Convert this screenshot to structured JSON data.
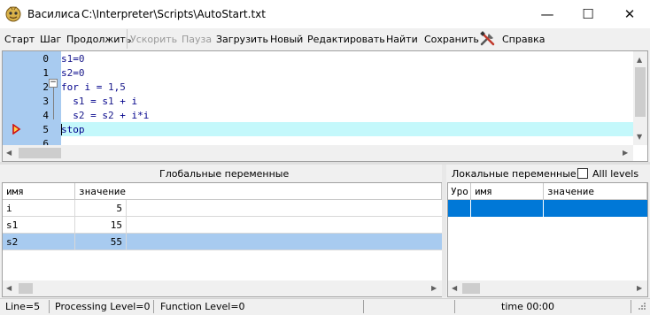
{
  "window": {
    "app_name": "Василиса",
    "file_path": "C:\\Interpreter\\Scripts\\AutoStart.txt",
    "minimize_glyph": "—",
    "maximize_glyph": "☐",
    "close_glyph": "✕"
  },
  "menu": {
    "start": "Старт",
    "step": "Шаг",
    "continue": "Продолжить",
    "speed_up": "Ускорить",
    "pause": "Пауза",
    "load": "Загрузить",
    "new": "Новый",
    "edit": "Редактировать",
    "find": "Найти",
    "save": "Сохранить",
    "help": "Справка"
  },
  "editor": {
    "line_numbers": [
      "0",
      "1",
      "2",
      "3",
      "4",
      "5",
      "6"
    ],
    "lines": [
      "s1=0",
      "s2=0",
      "for i = 1,5",
      "  s1 = s1 + i",
      "  s2 = s2 + i*i",
      "stop",
      ""
    ],
    "current_line": 5,
    "fold_glyph": "−"
  },
  "globals": {
    "title": "Глобальные переменные",
    "col_name": "имя",
    "col_value": "значение",
    "rows": [
      {
        "name": "i",
        "value": "5"
      },
      {
        "name": "s1",
        "value": "15"
      },
      {
        "name": "s2",
        "value": "55"
      }
    ],
    "selected_row": 2
  },
  "locals": {
    "title": "Локальные переменные",
    "all_levels_label": "Alll levels",
    "all_levels_checked": false,
    "col_level": "Уро",
    "col_name": "имя",
    "col_value": "значение"
  },
  "status": {
    "line": "Line=5",
    "processing_level": "Processing Level=0",
    "function_level": "Function Level=0",
    "time": "time 00:00"
  },
  "colors": {
    "gutter": "#a8cbf0",
    "current_line": "#c4f8fb",
    "selected_row": "#a8cbf0",
    "locals_selected": "#0078d7"
  }
}
